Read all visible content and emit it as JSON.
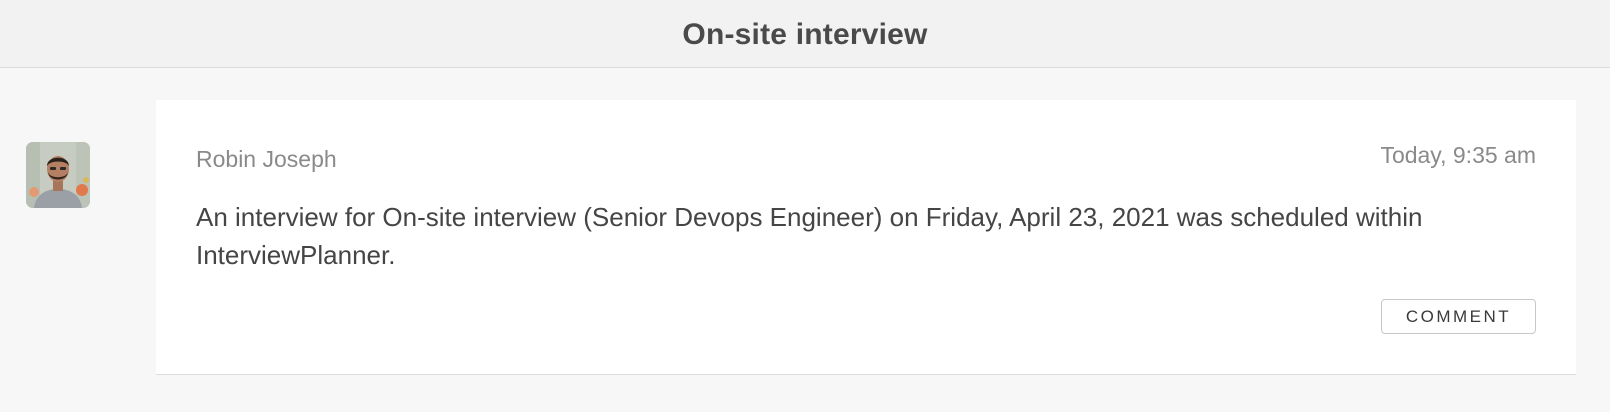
{
  "header": {
    "title": "On-site interview"
  },
  "activity": {
    "avatar_icon": "user-avatar-photo",
    "author": "Robin Joseph",
    "timestamp": "Today, 9:35 am",
    "message": "An interview for On-site interview (Senior Devops Engineer) on Friday, April 23, 2021 was scheduled within InterviewPlanner.",
    "comment_label": "COMMENT"
  }
}
